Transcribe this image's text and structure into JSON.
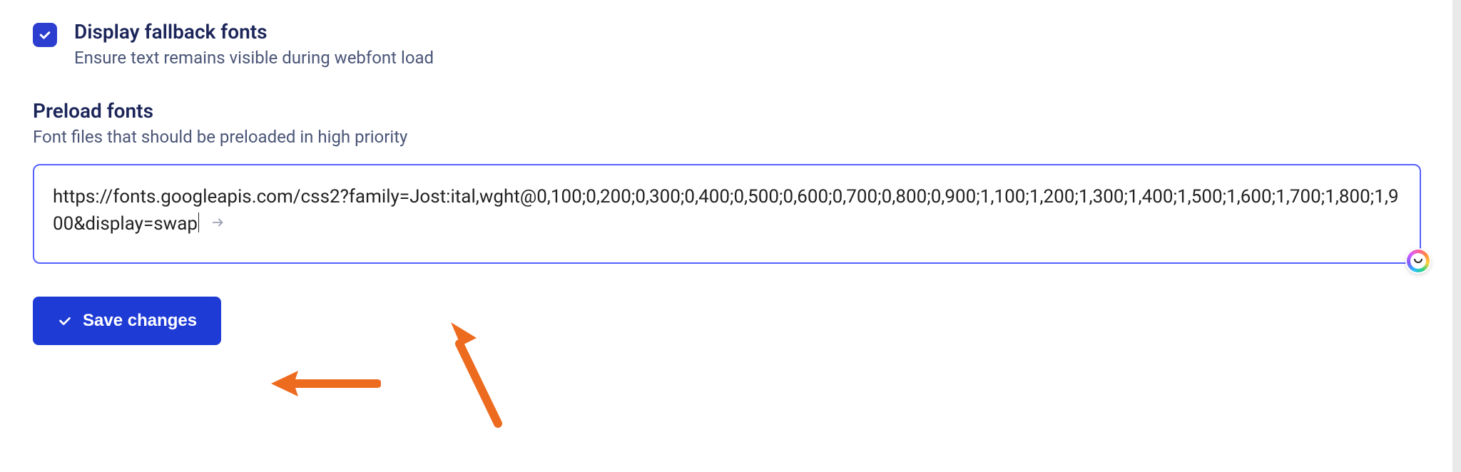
{
  "fallback": {
    "title": "Display fallback fonts",
    "description": "Ensure text remains visible during webfont load",
    "checked": true
  },
  "preload": {
    "title": "Preload fonts",
    "description": "Font files that should be preloaded in high priority",
    "value": "https://fonts.googleapis.com/css2?family=Jost:ital,wght@0,100;0,200;0,300;0,400;0,500;0,600;0,700;0,800;0,900;1,100;1,200;1,300;1,400;1,500;1,600;1,700;1,800;1,900&display=swap"
  },
  "actions": {
    "save_label": "Save changes"
  },
  "colors": {
    "accent": "#1f3bd6",
    "checkbox": "#2c3ecf",
    "focus_border": "#5561ff",
    "annotation": "#ed6b1f"
  }
}
